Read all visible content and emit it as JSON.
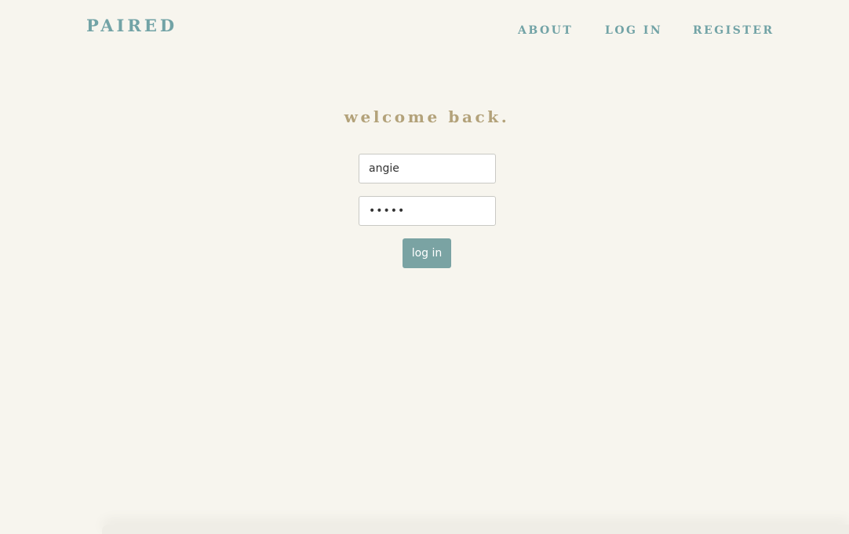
{
  "header": {
    "brand": "PAIRED",
    "nav": {
      "about": "ABOUT",
      "login": "LOG IN",
      "register": "REGISTER"
    }
  },
  "login_form": {
    "title": "welcome back.",
    "username_value": "angie",
    "password_value": "•••••",
    "submit_label": "log in"
  },
  "colors": {
    "background": "#f7f5ee",
    "brand": "#72a3a6",
    "title": "#b3a27a",
    "button": "#7aa3a3"
  }
}
